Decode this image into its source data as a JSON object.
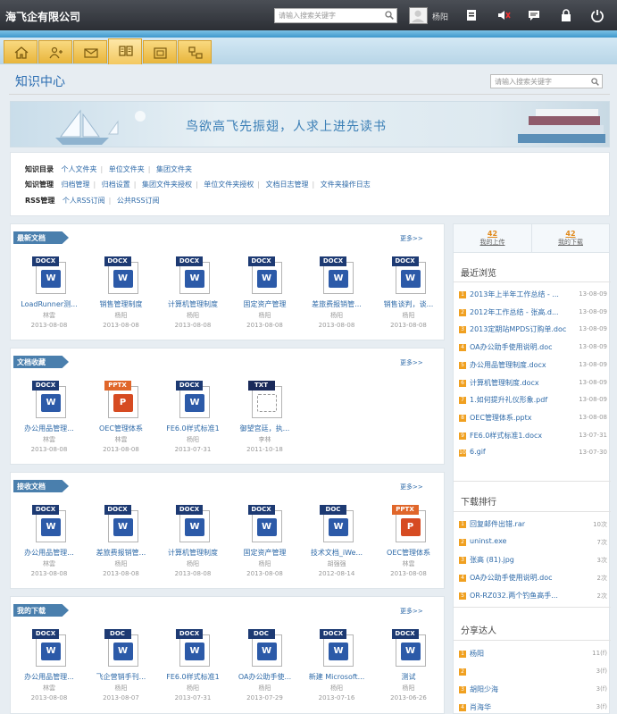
{
  "header": {
    "company": "海飞企有限公司",
    "search_placeholder": "请输入搜索关键字",
    "user": "杨阳"
  },
  "page": {
    "title": "知识中心",
    "search_placeholder": "请输入搜索关键字"
  },
  "banner": {
    "slogan": "鸟欲高飞先振翅，人求上进先读书"
  },
  "links": [
    {
      "label": "知识目录",
      "items": [
        "个人文件夹",
        "单位文件夹",
        "集团文件夹"
      ]
    },
    {
      "label": "知识管理",
      "items": [
        "归档管理",
        "归档设置",
        "集团文件夹授权",
        "单位文件夹授权",
        "文档日志管理",
        "文件夹操作日志"
      ]
    },
    {
      "label": "RSS管理",
      "items": [
        "个人RSS订阅",
        "公共RSS订阅"
      ]
    }
  ],
  "more_label": "更多>>",
  "panels": [
    {
      "title": "最新文档",
      "docs": [
        {
          "type": "DOCX",
          "name": "LoadRunner测...",
          "author": "林雲",
          "date": "2013-08-08"
        },
        {
          "type": "DOCX",
          "name": "销售管理制度",
          "author": "杨阳",
          "date": "2013-08-08"
        },
        {
          "type": "DOCX",
          "name": "计算机管理制度",
          "author": "杨阳",
          "date": "2013-08-08"
        },
        {
          "type": "DOCX",
          "name": "固定资产管理",
          "author": "杨阳",
          "date": "2013-08-08"
        },
        {
          "type": "DOCX",
          "name": "差旅费报销管...",
          "author": "杨阳",
          "date": "2013-08-08"
        },
        {
          "type": "DOCX",
          "name": "销售谈判，谈...",
          "author": "杨阳",
          "date": "2013-08-08"
        }
      ]
    },
    {
      "title": "文档收藏",
      "docs": [
        {
          "type": "DOCX",
          "name": "办公用品管理...",
          "author": "林雲",
          "date": "2013-08-08"
        },
        {
          "type": "PPTX",
          "name": "OEC管理体系",
          "author": "林雲",
          "date": "2013-08-08"
        },
        {
          "type": "DOCX",
          "name": "FE6.0样式标准1",
          "author": "杨阳",
          "date": "2013-07-31"
        },
        {
          "type": "TXT",
          "name": "御望宫廷，执...",
          "author": "李林",
          "date": "2011-10-18"
        }
      ]
    },
    {
      "title": "接收文档",
      "docs": [
        {
          "type": "DOCX",
          "name": "办公用品管理...",
          "author": "林雲",
          "date": "2013-08-08"
        },
        {
          "type": "DOCX",
          "name": "差旅费报销管...",
          "author": "杨阳",
          "date": "2013-08-08"
        },
        {
          "type": "DOCX",
          "name": "计算机管理制度",
          "author": "杨阳",
          "date": "2013-08-08"
        },
        {
          "type": "DOCX",
          "name": "固定资产管理",
          "author": "杨阳",
          "date": "2013-08-08"
        },
        {
          "type": "DOC",
          "name": "技术文档_iWe...",
          "author": "胡强强",
          "date": "2012-08-14"
        },
        {
          "type": "PPTX",
          "name": "OEC管理体系",
          "author": "林雲",
          "date": "2013-08-08"
        }
      ]
    },
    {
      "title": "我的下载",
      "docs": [
        {
          "type": "DOCX",
          "name": "办公用品管理...",
          "author": "林雲",
          "date": "2013-08-08"
        },
        {
          "type": "DOC",
          "name": "飞企营销手刊...",
          "author": "杨阳",
          "date": "2013-08-07"
        },
        {
          "type": "DOCX",
          "name": "FE6.0样式标准1",
          "author": "杨阳",
          "date": "2013-07-31"
        },
        {
          "type": "DOC",
          "name": "OA办公助手使...",
          "author": "杨阳",
          "date": "2013-07-29"
        },
        {
          "type": "DOCX",
          "name": "新建 Microsoft...",
          "author": "杨阳",
          "date": "2013-07-16"
        },
        {
          "type": "DOCX",
          "name": "测试",
          "author": "杨阳",
          "date": "2013-06-26"
        }
      ]
    }
  ],
  "sidebar": {
    "stats": [
      {
        "num": "42",
        "label": "我的上传"
      },
      {
        "num": "42",
        "label": "我的下载"
      }
    ],
    "recent_title": "最近浏览",
    "recent": [
      {
        "title": "2013年上半年工作总结 - ...",
        "date": "13-08-09"
      },
      {
        "title": "2012年工作总结 - 张高.d...",
        "date": "13-08-09"
      },
      {
        "title": "2013定期站MPDS订购单.doc",
        "date": "13-08-09"
      },
      {
        "title": "OA办公助手使用说明.doc",
        "date": "13-08-09"
      },
      {
        "title": "办公用品管理制度.docx",
        "date": "13-08-09"
      },
      {
        "title": "计算机管理制度.docx",
        "date": "13-08-09"
      },
      {
        "title": "1.如何提升礼仪形象.pdf",
        "date": "13-08-09"
      },
      {
        "title": "OEC管理体系.pptx",
        "date": "13-08-08"
      },
      {
        "title": "FE6.0样式标准1.docx",
        "date": "13-07-31"
      },
      {
        "title": "6.gif",
        "date": "13-07-30"
      }
    ],
    "download_title": "下载排行",
    "downloads": [
      {
        "title": "回复邮件出错.rar",
        "count": "10次"
      },
      {
        "title": "uninst.exe",
        "count": "7次"
      },
      {
        "title": "张高 (81).jpg",
        "count": "3次"
      },
      {
        "title": "OA办公助手使用说明.doc",
        "count": "2次"
      },
      {
        "title": "OR-RZ032.两个钓鱼高手...",
        "count": "2次"
      }
    ],
    "share_title": "分享达人",
    "sharers": [
      {
        "title": "杨阳",
        "count": "11(f)"
      },
      {
        "title": "",
        "count": "3(f)"
      },
      {
        "title": "胡阳少海",
        "count": "3(f)"
      },
      {
        "title": "肖海华",
        "count": "3(f)"
      }
    ]
  }
}
